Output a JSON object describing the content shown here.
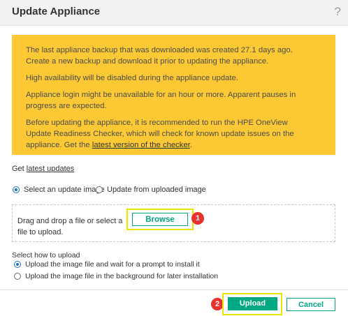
{
  "dialog": {
    "title": "Update Appliance",
    "help_icon": "?"
  },
  "warning": {
    "para1": "The last appliance backup that was downloaded was created 27.1 days ago. Create a new backup and download it prior to updating the appliance.",
    "para2": "High availability will be disabled during the appliance update.",
    "para3": "Appliance login might be unavailable for an hour or more. Apparent pauses in progress are expected.",
    "para4_prefix": "Before updating the appliance, it is recommended to run the HPE OneView Update Readiness Checker, which will check for known update issues on the appliance. Get the ",
    "para4_link": "latest version of the checker",
    "para4_suffix": ".",
    "background_color": "#fcc934"
  },
  "get_updates": {
    "prefix": "Get ",
    "link": "latest updates"
  },
  "image_source": {
    "options": [
      {
        "label": "Select an update image",
        "checked": true
      },
      {
        "label": "Update from uploaded image",
        "checked": false
      }
    ]
  },
  "dropzone": {
    "text": "Drag and drop a file or select a file to upload.",
    "browse_label": "Browse",
    "badge": "1"
  },
  "upload_mode": {
    "heading": "Select how to upload",
    "options": [
      {
        "label": "Upload the image file and wait for a prompt to install it",
        "checked": true
      },
      {
        "label": "Upload the image file in the background for later installation",
        "checked": false
      }
    ]
  },
  "footer": {
    "upload_label": "Upload",
    "cancel_label": "Cancel",
    "badge": "2"
  },
  "colors": {
    "accent": "#01a982",
    "highlight": "#e6e600",
    "badge": "#e8322d",
    "radio_selected": "#1a6fc4"
  }
}
